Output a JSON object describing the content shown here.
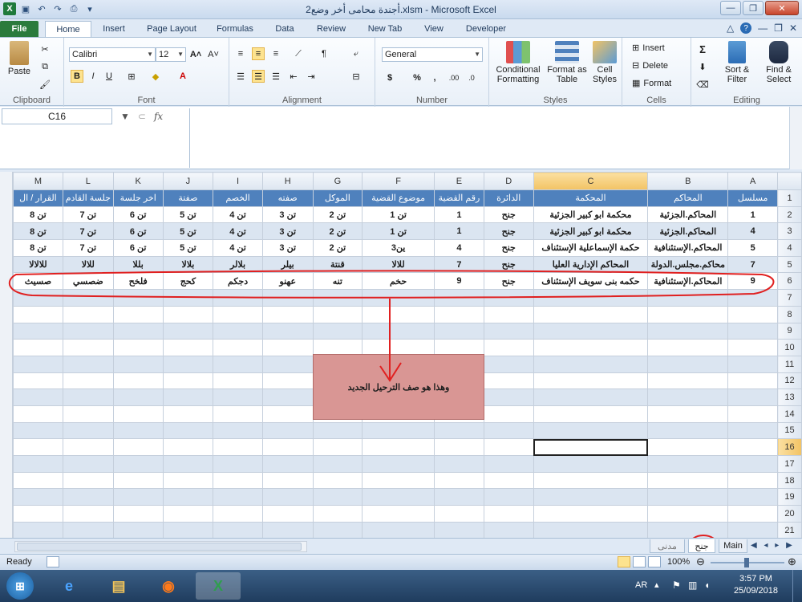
{
  "window": {
    "title": "أجندة محامى أخر وضع2.xlsm - Microsoft Excel"
  },
  "ribbon": {
    "tabs": [
      "File",
      "Home",
      "Insert",
      "Page Layout",
      "Formulas",
      "Data",
      "Review",
      "New Tab",
      "View",
      "Developer"
    ],
    "active_tab": "Home",
    "clipboard": {
      "paste": "Paste",
      "label": "Clipboard"
    },
    "font": {
      "family": "Calibri",
      "size": "12",
      "label": "Font"
    },
    "alignment": {
      "label": "Alignment"
    },
    "number": {
      "format": "General",
      "label": "Number",
      "currency": "$",
      "percent": "%",
      "comma": ",",
      "inc_dec": ".00",
      "dec_dec": ".0"
    },
    "styles": {
      "conditional": "Conditional Formatting",
      "format_table": "Format as Table",
      "cell_styles": "Cell Styles",
      "label": "Styles"
    },
    "cells": {
      "insert": "Insert",
      "delete": "Delete",
      "format": "Format",
      "label": "Cells"
    },
    "editing": {
      "sort": "Sort & Filter",
      "find": "Find & Select",
      "label": "Editing",
      "sum": "Σ"
    }
  },
  "formula_bar": {
    "name_box": "C16",
    "fx": "fx",
    "content": ""
  },
  "sheet": {
    "columns": [
      "M",
      "L",
      "K",
      "J",
      "I",
      "H",
      "G",
      "F",
      "E",
      "D",
      "C",
      "B",
      "A"
    ],
    "active_column": "C",
    "header_row": [
      "القرار / ال",
      "جلسة القادم",
      "اخر جلسة",
      "صفتة",
      "الخصم",
      "صفته",
      "الموكل",
      "موضوع القضية",
      "رقم القضية",
      "الدائرة",
      "المحكمة",
      "المحاكم",
      "مسلسل"
    ],
    "data_rows": [
      [
        "تن 8",
        "تن 7",
        "تن 6",
        "تن 5",
        "تن 4",
        "تن 3",
        "تن 2",
        "تن 1",
        "1",
        "جنح",
        "محكمة ابو كبير الجزئية",
        "المحاكم.الجزئية",
        "1"
      ],
      [
        "تن 8",
        "تن 7",
        "تن 6",
        "تن 5",
        "تن 4",
        "تن 3",
        "تن 2",
        "تن 1",
        "1",
        "جنح",
        "محكمة ابو كبير الجزئية",
        "المحاكم.الجزئية",
        "4"
      ],
      [
        "تن 8",
        "تن 7",
        "تن 6",
        "تن 5",
        "تن 4",
        "تن 3",
        "تن 2",
        "ين3",
        "4",
        "جنح",
        "حكمة الإسماعلية الإستئناف",
        "المحاكم.الإستئنافية",
        "5"
      ],
      [
        "للالالا",
        "للالا",
        "بللا",
        "بلالا",
        "بلالر",
        "بيلر",
        "قنتة",
        "للالا",
        "7",
        "جنح",
        "المحاكم الإدارية العليا",
        "محاكم.مجلس.الدولة",
        "7"
      ],
      [
        "صسيث",
        "ضصسي",
        "فلخح",
        "كحج",
        "دجكم",
        "عهنو",
        "تنه",
        "حخم",
        "9",
        "جنح",
        "حكمه بنى سويف الإستئناف",
        "المحاكم.الإستئنافية",
        "9"
      ]
    ],
    "row_numbers": [
      "1",
      "2",
      "3",
      "4",
      "5",
      "6",
      "7",
      "8",
      "9",
      "10",
      "11",
      "12",
      "13",
      "14",
      "15",
      "16",
      "17",
      "18",
      "19",
      "20",
      "21"
    ],
    "active_row": "16",
    "note_text": "وهذا هو صف الترحيل الجديد"
  },
  "sheet_tabs": [
    "Main",
    "جنح",
    "مدنى"
  ],
  "active_sheet": "جنح",
  "status": {
    "ready": "Ready",
    "zoom": "100%"
  },
  "taskbar": {
    "lang": "AR",
    "time": "3:57 PM",
    "date": "25/09/2018"
  },
  "colors": {
    "header_fill": "#4f81bd",
    "band_fill": "#dbe5f1",
    "annotation": "#e02020",
    "note_fill": "#d99694"
  }
}
